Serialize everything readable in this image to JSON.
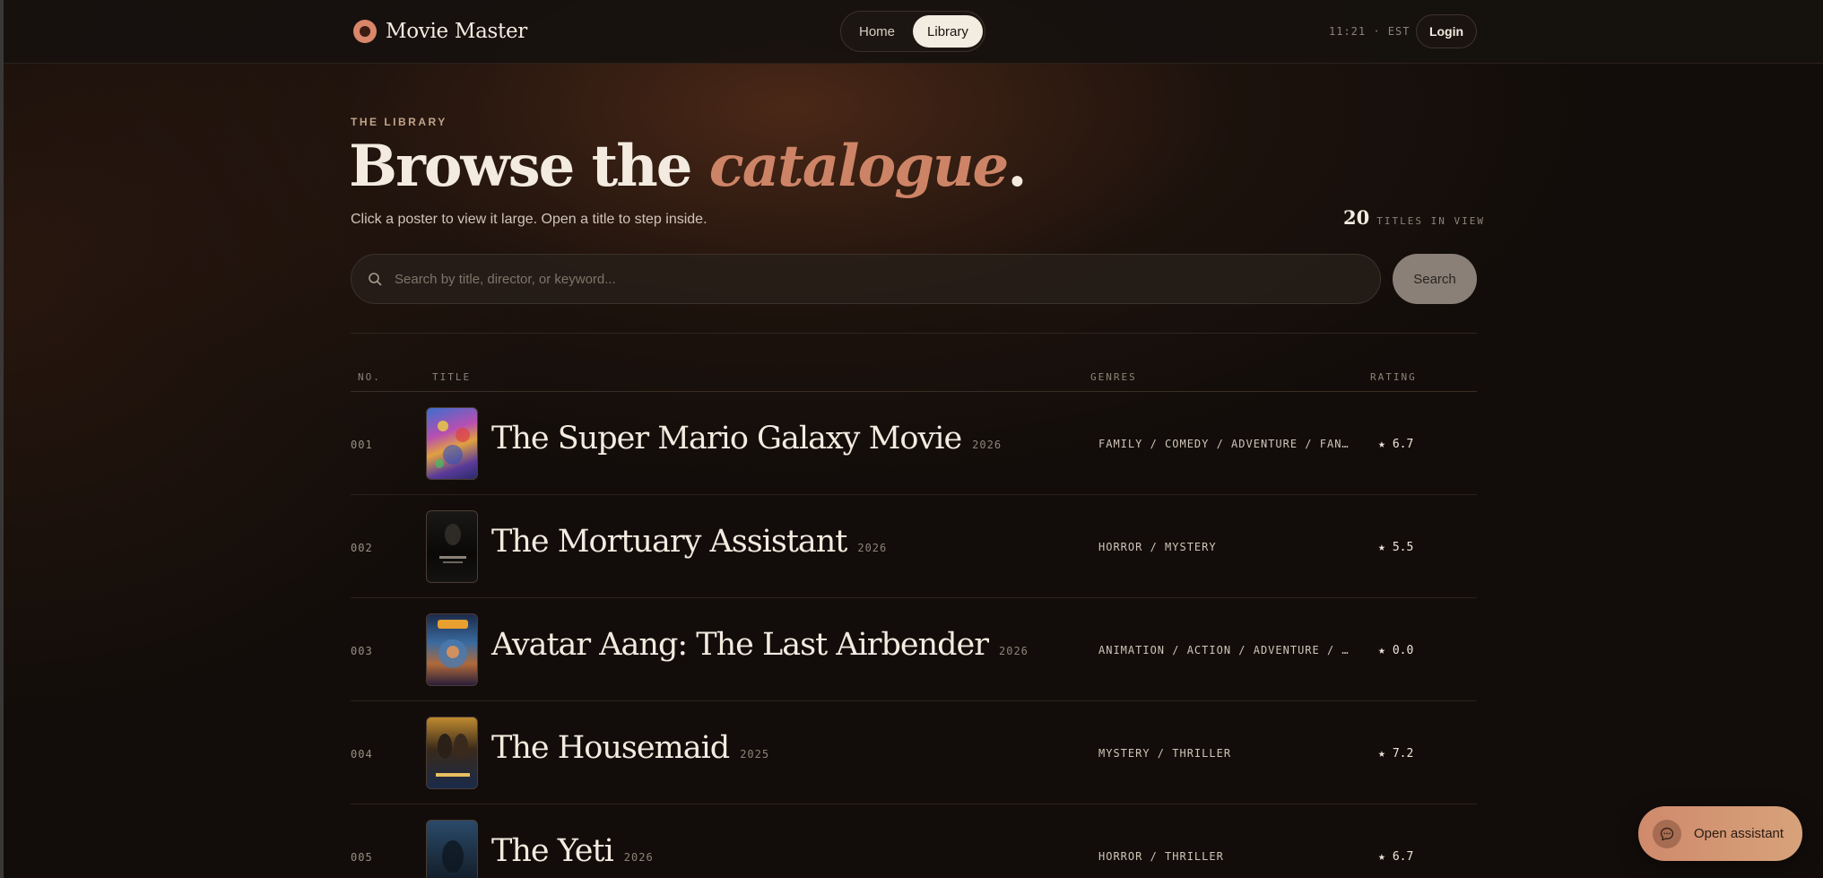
{
  "header": {
    "brand": "Movie Master",
    "nav": [
      {
        "label": "Home",
        "active": false
      },
      {
        "label": "Library",
        "active": true
      }
    ],
    "clock": "11:21 · EST",
    "login_label": "Login"
  },
  "hero": {
    "eyebrow": "THE LIBRARY",
    "headline_prefix": "Browse the ",
    "headline_accent": "catalogue",
    "headline_suffix": ".",
    "subline": "Click a poster to view it large. Open a title to step inside.",
    "count_number": "20",
    "count_label": "TITLES IN VIEW"
  },
  "search": {
    "placeholder": "Search by title, director, or keyword...",
    "value": "",
    "button_label": "Search"
  },
  "table": {
    "columns": {
      "no": "NO.",
      "title": "TITLE",
      "genres": "GENRES",
      "rating": "RATING"
    },
    "rows": [
      {
        "no": "001",
        "title": "The Super Mario Galaxy Movie",
        "year": "2026",
        "genres": "FAMILY / COMEDY / ADVENTURE / FANTASY / ANIMATION",
        "rating": "6.7"
      },
      {
        "no": "002",
        "title": "The Mortuary Assistant",
        "year": "2026",
        "genres": "HORROR / MYSTERY",
        "rating": "5.5"
      },
      {
        "no": "003",
        "title": "Avatar Aang: The Last Airbender",
        "year": "2026",
        "genres": "ANIMATION / ACTION / ADVENTURE / FANTASY",
        "rating": "0.0"
      },
      {
        "no": "004",
        "title": "The Housemaid",
        "year": "2025",
        "genres": "MYSTERY / THRILLER",
        "rating": "7.2"
      },
      {
        "no": "005",
        "title": "The Yeti",
        "year": "2026",
        "genres": "HORROR / THRILLER",
        "rating": "6.7"
      }
    ]
  },
  "assistant": {
    "label": "Open assistant"
  },
  "colors": {
    "accent": "#cd8466",
    "background": "#120d0a",
    "text": "#f3ebe0"
  }
}
